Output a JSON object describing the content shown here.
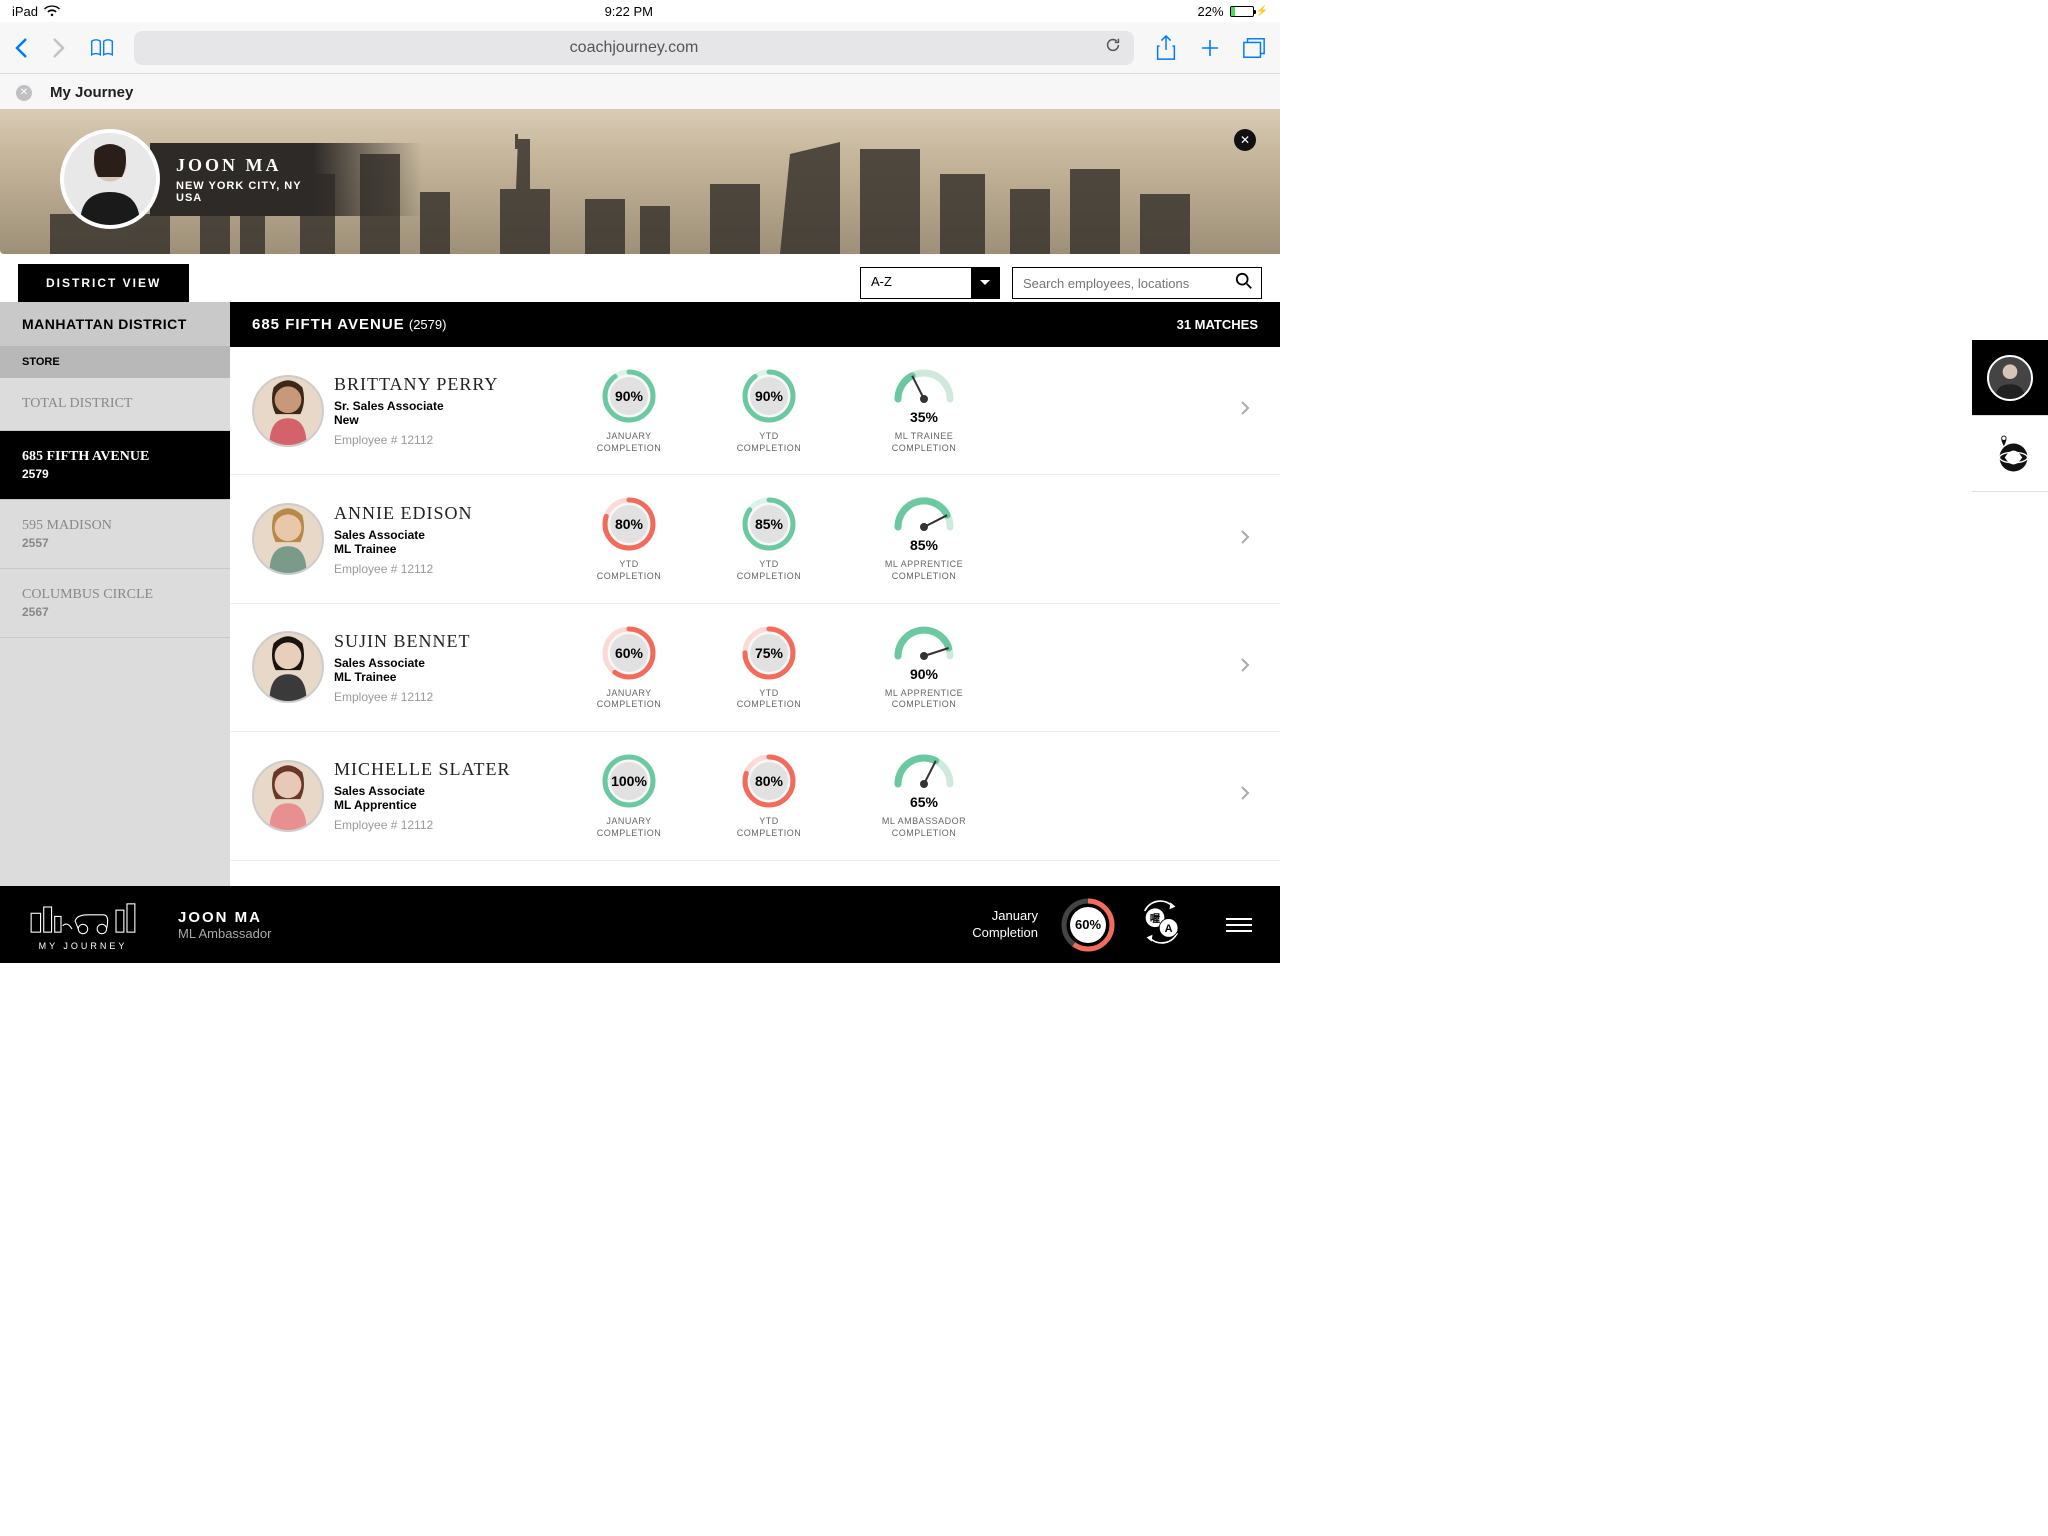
{
  "status": {
    "device": "iPad",
    "time": "9:22 PM",
    "battery_pct": "22%"
  },
  "browser": {
    "url": "coachjourney.com",
    "tab_title": "My Journey"
  },
  "hero": {
    "name": "JOON MA",
    "location": "NEW YORK CITY, NY",
    "country": "USA"
  },
  "controls": {
    "district_label": "DISTRICT VIEW",
    "sort": "A-Z",
    "search_placeholder": "Search employees, locations"
  },
  "sidebar": {
    "district": "MANHATTAN DISTRICT",
    "section_label": "STORE",
    "items": [
      {
        "name": "TOTAL DISTRICT",
        "sub": ""
      },
      {
        "name": "685 FIFTH AVENUE",
        "sub": "2579"
      },
      {
        "name": "595 MADISON",
        "sub": "2557"
      },
      {
        "name": "COLUMBUS CIRCLE",
        "sub": "2567"
      }
    ]
  },
  "content_header": {
    "store": "685 FIFTH AVENUE",
    "id": "(2579)",
    "matches": "31 MATCHES"
  },
  "employees": [
    {
      "name": "BRITTANY PERRY",
      "role": "Sr. Sales Associate",
      "level": "New",
      "emp_id": "Employee # 12112",
      "m1": {
        "pct": "90%",
        "val": 90,
        "color": "#6bc9a2",
        "l1": "JANUARY",
        "l2": "COMPLETION"
      },
      "m2": {
        "pct": "90%",
        "val": 90,
        "color": "#6bc9a2",
        "l1": "YTD",
        "l2": "COMPLETION"
      },
      "m3": {
        "pct": "35%",
        "val": 35,
        "l1": "ML TRAINEE",
        "l2": "COMPLETION"
      }
    },
    {
      "name": "ANNIE EDISON",
      "role": "Sales Associate",
      "level": "ML Trainee",
      "emp_id": "Employee # 12112",
      "m1": {
        "pct": "80%",
        "val": 80,
        "color": "#f26b5b",
        "l1": "YTD",
        "l2": "COMPLETION"
      },
      "m2": {
        "pct": "85%",
        "val": 85,
        "color": "#6bc9a2",
        "l1": "YTD",
        "l2": "COMPLETION"
      },
      "m3": {
        "pct": "85%",
        "val": 85,
        "l1": "ML APPRENTICE",
        "l2": "COMPLETION"
      }
    },
    {
      "name": "SUJIN BENNET",
      "role": "Sales Associate",
      "level": "ML Trainee",
      "emp_id": "Employee # 12112",
      "m1": {
        "pct": "60%",
        "val": 60,
        "color": "#f26b5b",
        "l1": "JANUARY",
        "l2": "COMPLETION"
      },
      "m2": {
        "pct": "75%",
        "val": 75,
        "color": "#f26b5b",
        "l1": "YTD",
        "l2": "COMPLETION"
      },
      "m3": {
        "pct": "90%",
        "val": 90,
        "l1": "ML APPRENTICE",
        "l2": "COMPLETION"
      }
    },
    {
      "name": "MICHELLE SLATER",
      "role": "Sales Associate",
      "level": "ML Apprentice",
      "emp_id": "Employee # 12112",
      "m1": {
        "pct": "100%",
        "val": 100,
        "color": "#6bc9a2",
        "l1": "JANUARY",
        "l2": "COMPLETION"
      },
      "m2": {
        "pct": "80%",
        "val": 80,
        "color": "#f26b5b",
        "l1": "YTD",
        "l2": "COMPLETION"
      },
      "m3": {
        "pct": "65%",
        "val": 65,
        "l1": "ML AMBASSADOR",
        "l2": "COMPLETION"
      }
    }
  ],
  "footer": {
    "brand": "MY JOURNEY",
    "user_name": "JOON MA",
    "user_role": "ML Ambassador",
    "metric_label_1": "January",
    "metric_label_2": "Completion",
    "metric_pct": "60%",
    "metric_val": 60
  }
}
